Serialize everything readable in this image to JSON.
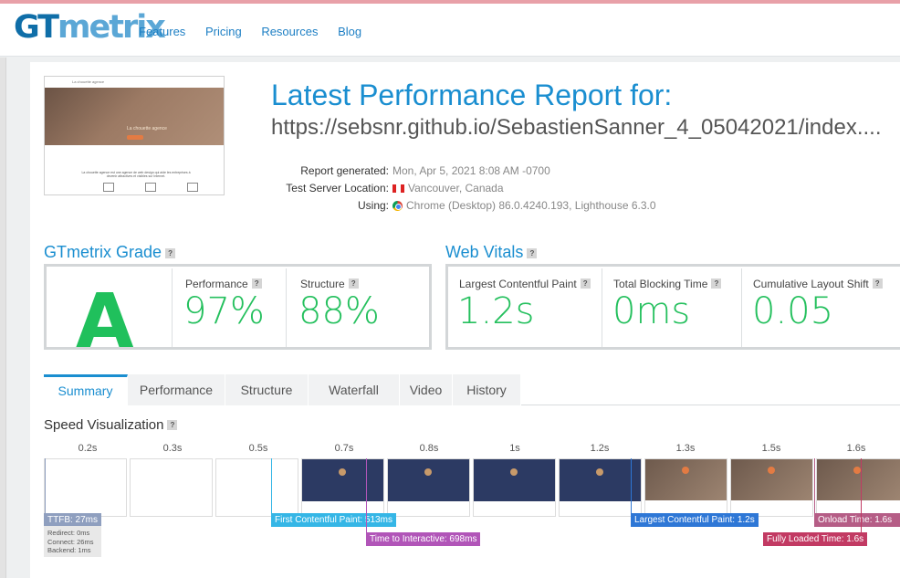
{
  "header": {
    "logo_main": "GT",
    "logo_rest": "metrix",
    "nav": [
      "Features",
      "Pricing",
      "Resources",
      "Blog"
    ]
  },
  "thumbnail": {
    "site_name": "La chouette agence",
    "hero_title": "La chouette agence",
    "description": "La chouette agence est une agence de web design qui aide les entreprises à devenir attractives et visibles sur Internet."
  },
  "report": {
    "title": "Latest Performance Report for:",
    "url": "https://sebsnr.github.io/SebastienSanner_4_05042021/index....",
    "generated_label": "Report generated:",
    "generated_value": "Mon, Apr 5, 2021 8:08 AM -0700",
    "location_label": "Test Server Location:",
    "location_value": "Vancouver, Canada",
    "using_label": "Using:",
    "using_value": "Chrome (Desktop) 86.0.4240.193, Lighthouse 6.3.0"
  },
  "grade": {
    "title": "GTmetrix Grade",
    "letter": "A",
    "performance_label": "Performance",
    "performance_value": "97%",
    "structure_label": "Structure",
    "structure_value": "88%"
  },
  "vitals": {
    "title": "Web Vitals",
    "lcp_label": "Largest Contentful Paint",
    "lcp_value": "1.2s",
    "tbt_label": "Total Blocking Time",
    "tbt_value": "0ms",
    "cls_label": "Cumulative Layout Shift",
    "cls_value": "0.05"
  },
  "tabs": [
    "Summary",
    "Performance",
    "Structure",
    "Waterfall",
    "Video",
    "History"
  ],
  "speed": {
    "title": "Speed Visualization",
    "ticks": [
      "0.2s",
      "0.3s",
      "0.5s",
      "0.7s",
      "0.8s",
      "1s",
      "1.2s",
      "1.3s",
      "1.5s",
      "1.6s"
    ],
    "ttfb": "TTFB: 27ms",
    "redirect": "Redirect: 0ms",
    "connect": "Connect: 26ms",
    "backend": "Backend: 1ms",
    "fcp": "First Contentful Paint: 513ms",
    "tti": "Time to Interactive: 698ms",
    "lcp": "Largest Contentful Paint: 1.2s",
    "onload": "Onload Time: 1.6s",
    "fully_loaded": "Fully Loaded Time: 1.6s"
  },
  "colors": {
    "brand": "#1a8ed0",
    "grade_green": "#20c05c",
    "ttfb": "#8f9fbf",
    "fcp": "#35b6e6",
    "tti": "#b155b8",
    "lcp": "#2e77d6",
    "onload": "#b55d86",
    "fully_loaded": "#c23a63"
  }
}
